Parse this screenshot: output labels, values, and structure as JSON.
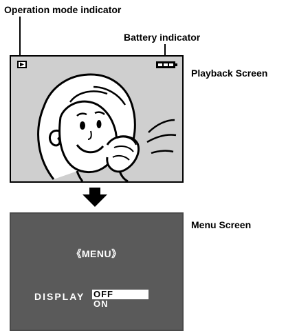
{
  "labels": {
    "operation_mode_indicator": "Operation mode indicator",
    "battery_indicator": "Battery indicator",
    "playback_screen": "Playback Screen",
    "menu_screen": "Menu Screen"
  },
  "playback": {
    "mode_icon": "play-icon",
    "battery_icon": "battery-full-icon",
    "illustration": "woman-with-glass-illustration"
  },
  "menu": {
    "title": "《MENU》",
    "setting_label": "DISPLAY",
    "options": [
      "OFF",
      "ON"
    ],
    "selected": "OFF"
  },
  "colors": {
    "playback_bg": "#cfcfcf",
    "menu_bg": "#5a5a5a",
    "highlight": "#ffffff"
  }
}
